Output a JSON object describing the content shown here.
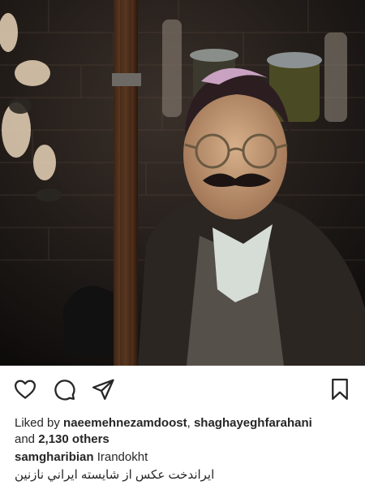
{
  "post": {
    "image": {
      "description_icon": "photo"
    },
    "actions": {
      "like_icon": "heart-outline-icon",
      "comment_icon": "speech-bubble-icon",
      "share_icon": "paper-plane-icon",
      "save_icon": "bookmark-outline-icon"
    },
    "likes": {
      "prefix": "Liked by ",
      "user1": "naeemehnezamdoost",
      "separator": ", ",
      "user2": "shaghayeghfarahani",
      "and": "and ",
      "others": "2,130 others"
    },
    "caption": {
      "author": "samgharibian",
      "text": " Irandokht",
      "text_fa": "ايراندخت عكس از شايسته ايراني نازنين"
    }
  }
}
